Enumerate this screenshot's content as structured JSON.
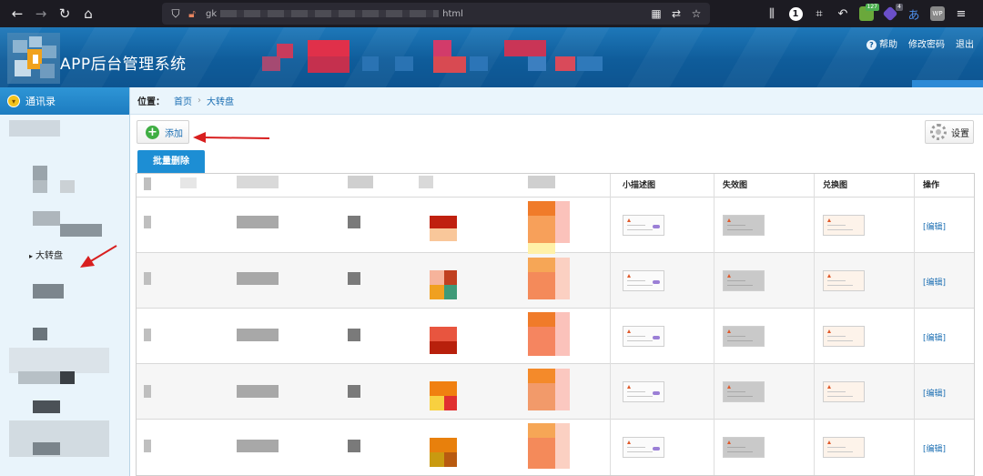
{
  "browser": {
    "url_prefix": "gk",
    "url_suffix": "html",
    "badges": [
      "127",
      "4"
    ],
    "extension_label": "WP"
  },
  "header": {
    "app_title": "APP后台管理系统",
    "links": {
      "help": "帮助",
      "change_password": "修改密码",
      "logout": "退出"
    }
  },
  "sidebar": {
    "title": "通讯录",
    "active_item": "大转盘"
  },
  "breadcrumb": {
    "label": "位置：",
    "items": [
      "首页",
      "大转盘"
    ]
  },
  "toolbar": {
    "add_label": "添加",
    "settings_label": "设置",
    "batch_delete_label": "批量删除"
  },
  "table": {
    "headers": {
      "small_image": "小描述图",
      "invalid_image": "失效图",
      "redeem_image": "兑换图",
      "action": "操作"
    },
    "rows": [
      {
        "action": "[编辑]"
      },
      {
        "action": "[编辑]"
      },
      {
        "action": "[编辑]"
      },
      {
        "action": "[编辑]"
      },
      {
        "action": "[编辑]"
      }
    ]
  },
  "colors": {
    "header_blue": "#0f5c9a",
    "accent_blue": "#1d8ed4",
    "link_blue": "#1c6fb3",
    "annotation_red": "#d81f1f"
  }
}
